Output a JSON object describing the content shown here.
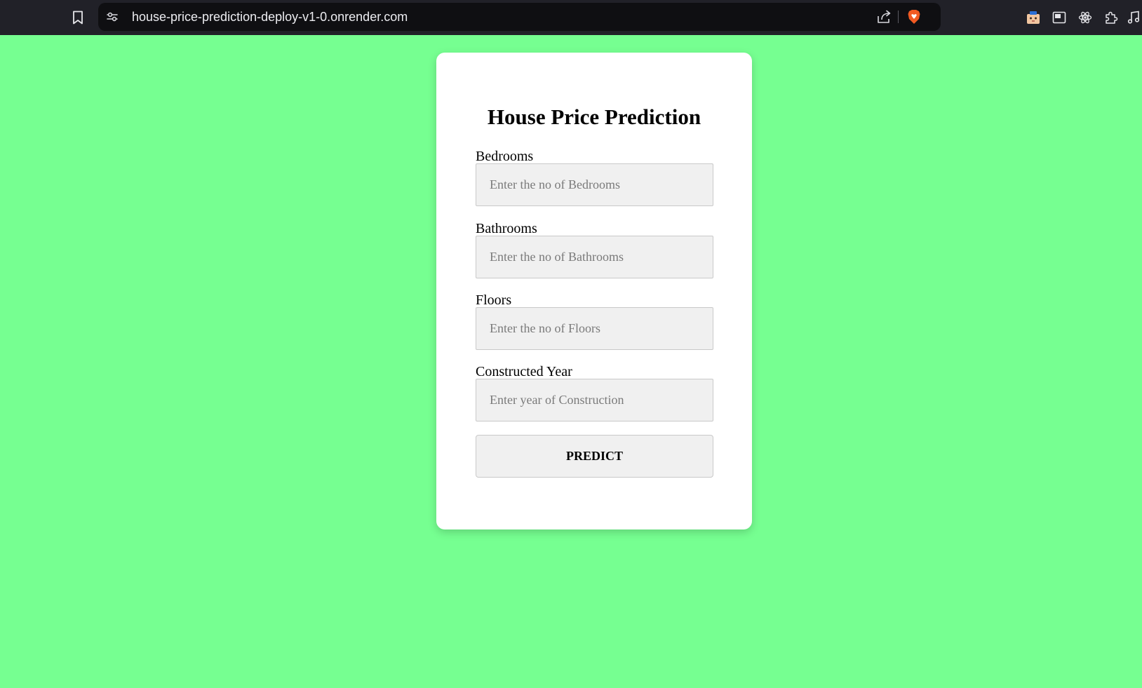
{
  "browser": {
    "url": "house-price-prediction-deploy-v1-0.onrender.com",
    "icons": {
      "bookmark": "bookmark-icon",
      "site_settings": "site-settings-icon",
      "share": "share-icon",
      "shields": "brave-shields-icon",
      "extensions": [
        "wallet-extension-icon",
        "picture-in-picture-icon",
        "react-devtools-icon",
        "puzzle-extensions-icon",
        "music-icon"
      ]
    }
  },
  "form": {
    "title": "House Price Prediction",
    "fields": [
      {
        "label": "Bedrooms",
        "placeholder": "Enter the no of Bedrooms",
        "value": ""
      },
      {
        "label": "Bathrooms",
        "placeholder": "Enter the no of Bathrooms",
        "value": ""
      },
      {
        "label": "Floors",
        "placeholder": "Enter the no of Floors",
        "value": ""
      },
      {
        "label": "Constructed Year",
        "placeholder": "Enter year of Construction",
        "value": ""
      }
    ],
    "submit_label": "PREDICT"
  },
  "colors": {
    "page_background": "#76ff91",
    "card_background": "#ffffff",
    "toolbar_background": "#212128",
    "input_background": "#f0f0f0",
    "brave_orange": "#f15a22"
  }
}
